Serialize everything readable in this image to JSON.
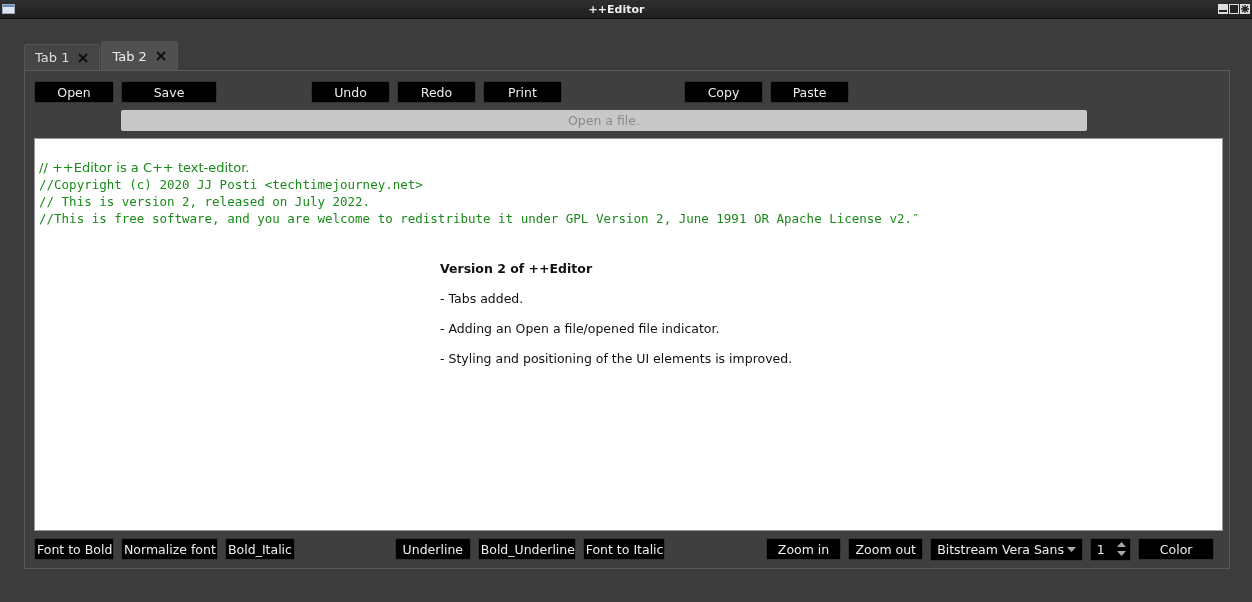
{
  "window": {
    "title": "++Editor"
  },
  "tabs": [
    {
      "label": "Tab 1",
      "selected": false
    },
    {
      "label": "Tab 2",
      "selected": true
    }
  ],
  "toolbar": [
    [
      "Open",
      "Save"
    ],
    [
      "Undo",
      "Redo",
      "Print"
    ],
    [
      "Copy",
      "Paste"
    ]
  ],
  "status": {
    "text": "Open a file."
  },
  "editor": {
    "comment_lines": [
      {
        "kind": "sans",
        "text": "// ++Editor is a C++ text-editor."
      },
      {
        "kind": "mono",
        "text": "//Copyright (c) 2020 JJ Posti <techtimejourney.net>"
      },
      {
        "kind": "mono",
        "text": "// This is version 2, released on July 2022."
      },
      {
        "kind": "mono",
        "text": "//This is free software, and you are welcome to redistribute it under GPL Version 2, June 1991 OR Apache License v2.″"
      }
    ],
    "heading": "Version 2 of ++Editor",
    "notes": [
      "- Tabs added.",
      "- Adding an Open a file/opened file indicator.",
      "- Styling and positioning of the UI elements is improved."
    ]
  },
  "format_bar": [
    [
      "Font to Bold",
      "Normalize font",
      "Bold_Italic"
    ],
    [
      "Underline",
      "Bold_Underline",
      "Font to Italic"
    ],
    [
      "Zoom in",
      "Zoom out"
    ]
  ],
  "font_combo": {
    "value": "Bitstream Vera Sans"
  },
  "size_spin": {
    "value": "1"
  },
  "color_button": "Color"
}
